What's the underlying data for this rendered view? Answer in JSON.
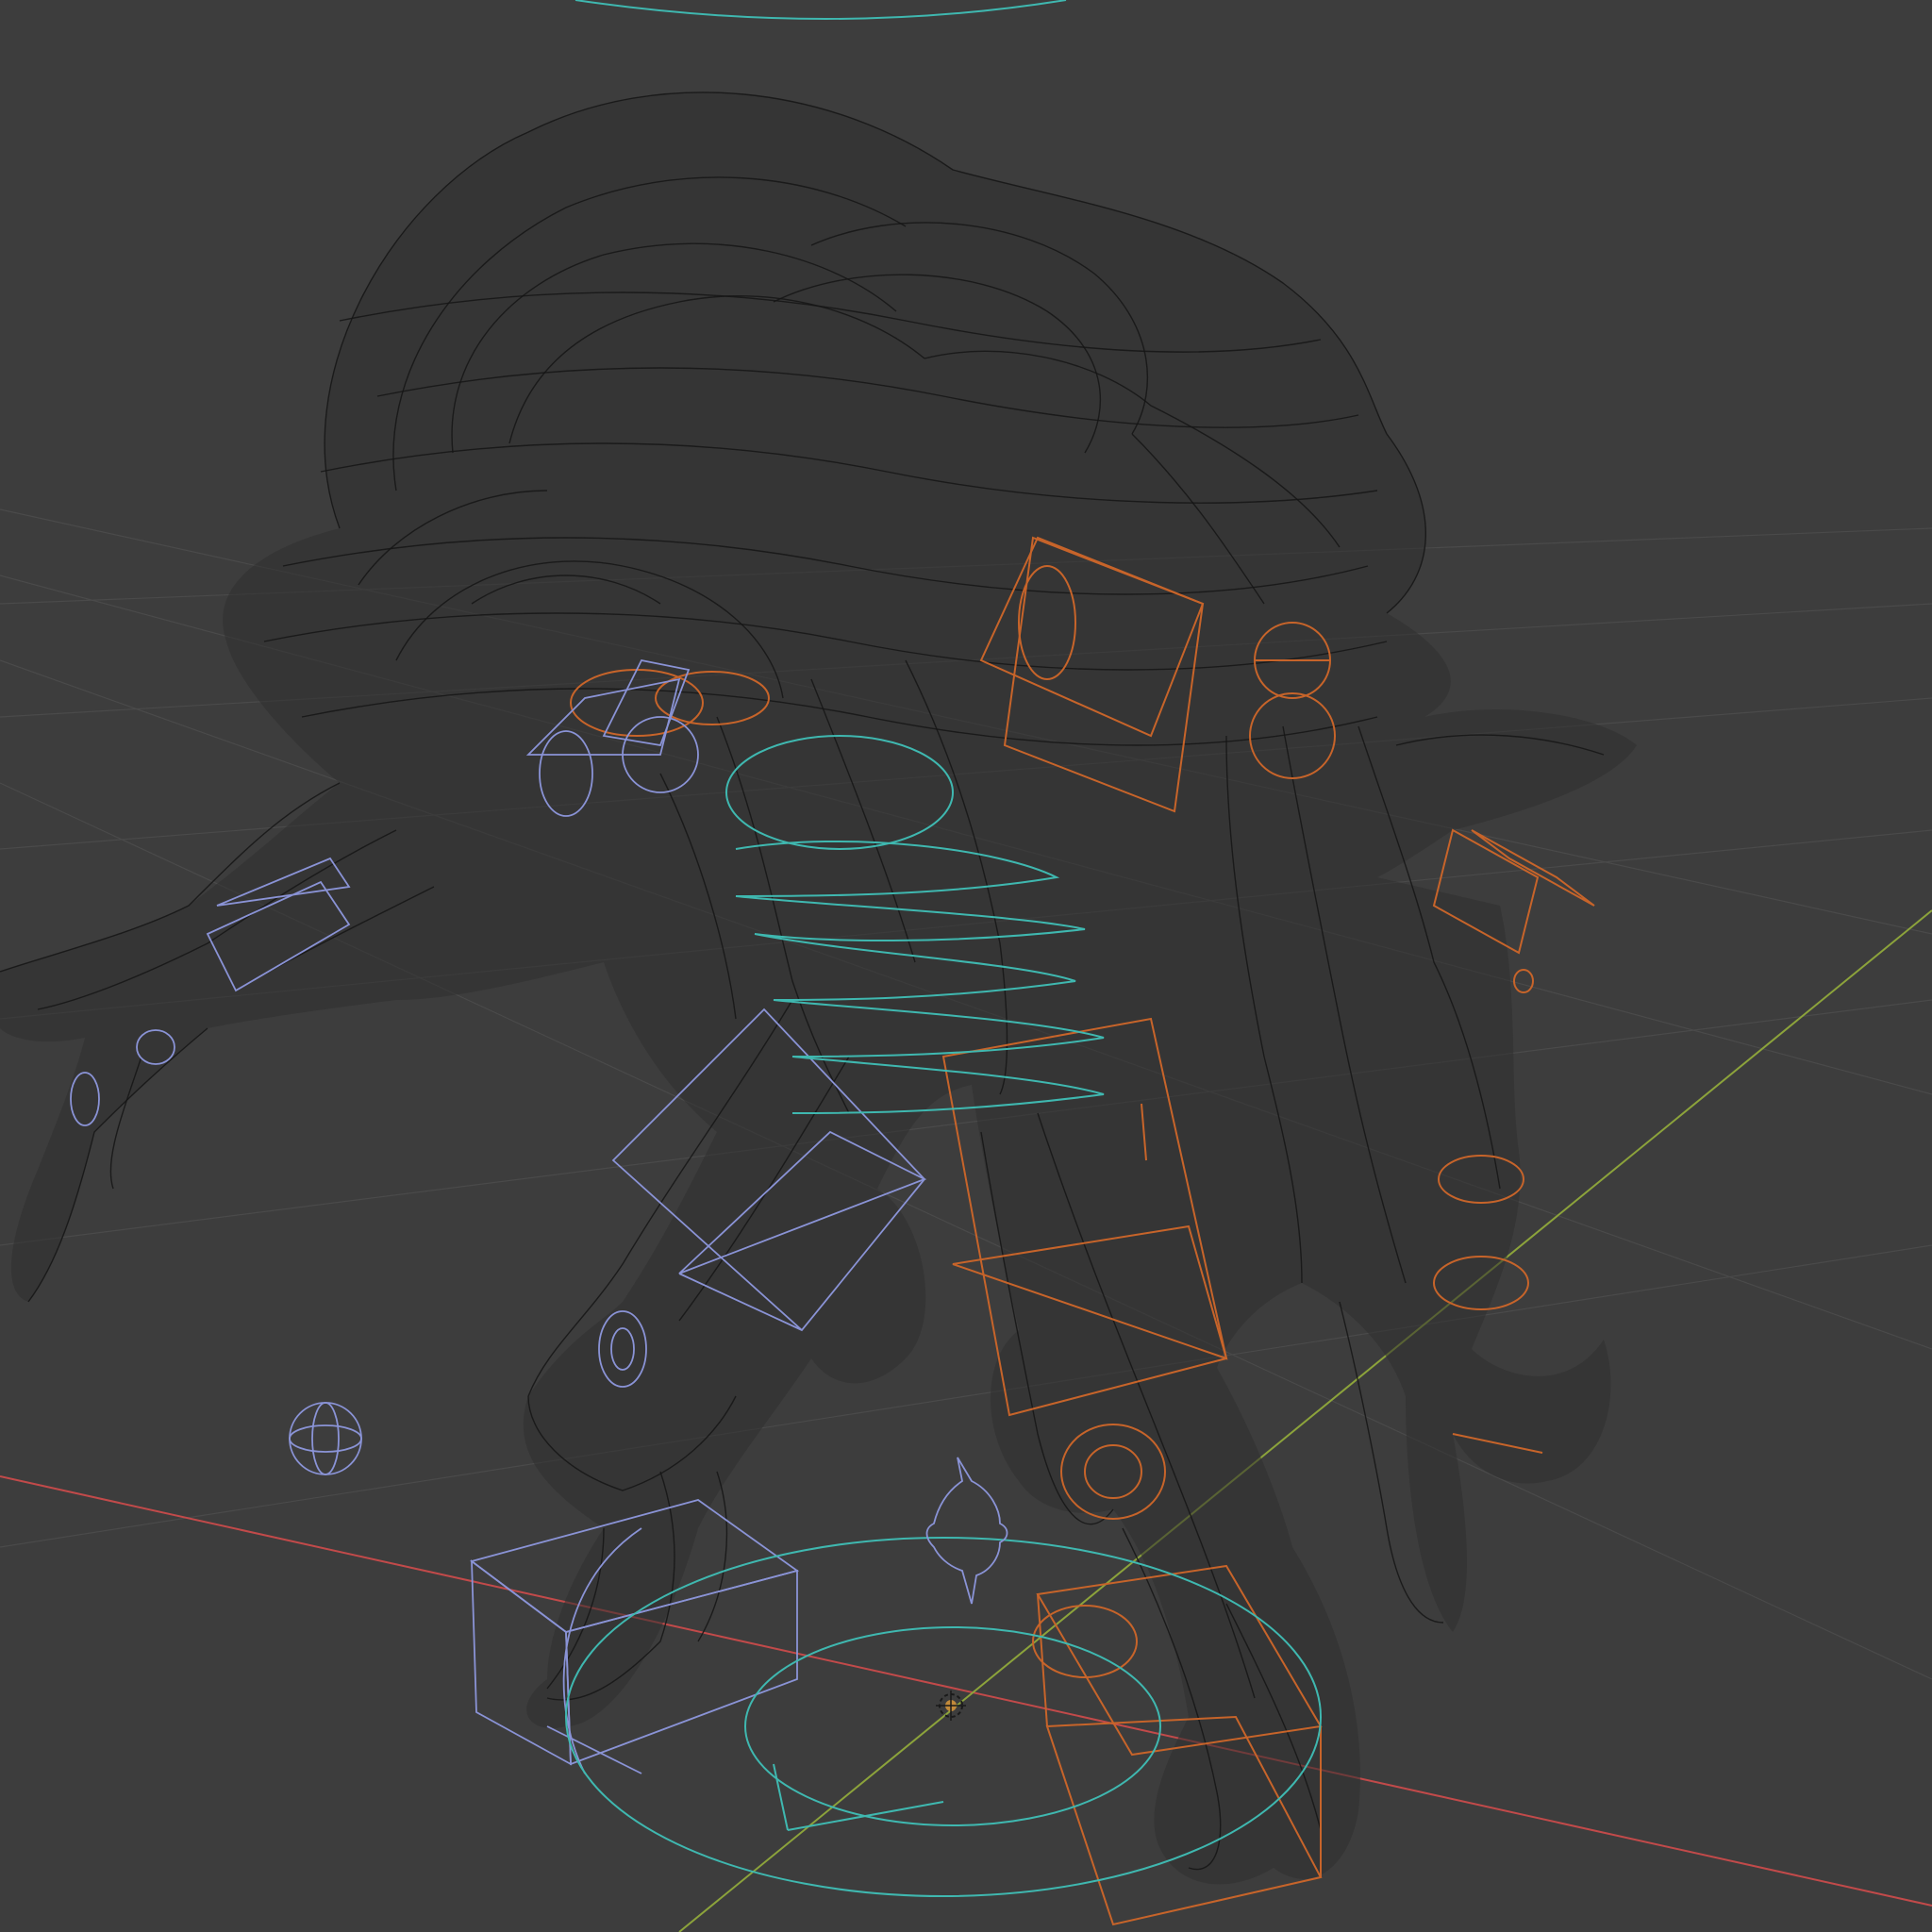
{
  "viewport": {
    "background": "#3d3d3d",
    "display_mode": "wireframe",
    "axes": {
      "x_axis_color": "#c24a4a",
      "y_axis_color": "#8ca33b"
    },
    "mesh_color": "#151515",
    "rig_colors": {
      "selected_bones": "#c7642a",
      "unselected_bones": "#8a93d6",
      "spine_controls": "#3fb8b0"
    },
    "icons": {
      "origin": "origin-cursor-icon",
      "empty": "empty-sphere-icon",
      "light": "light-icon"
    }
  }
}
